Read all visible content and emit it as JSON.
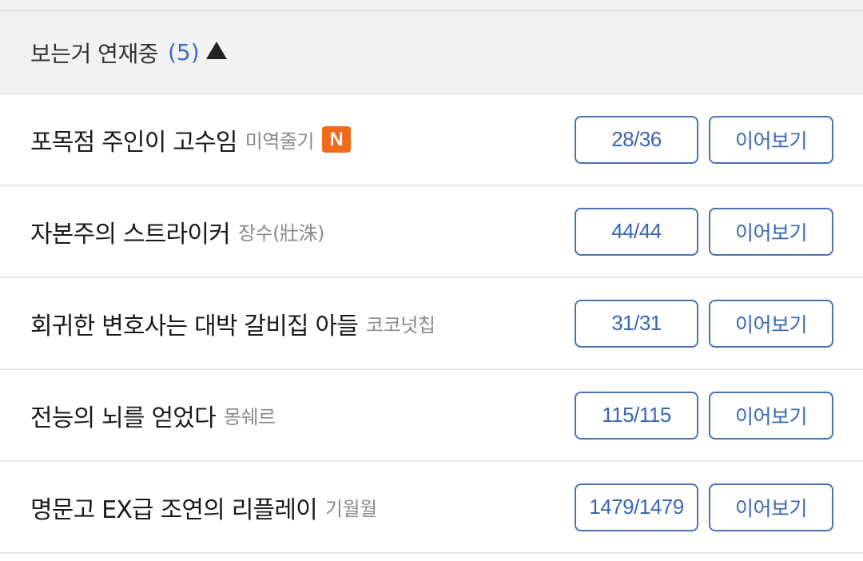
{
  "section": {
    "title": "보는거 연재중",
    "count": "(5)"
  },
  "items": [
    {
      "title": "포목점 주인이 고수임",
      "author": "미역줄기",
      "badge": "N",
      "progress": "28/36",
      "action": "이어보기"
    },
    {
      "title": "자본주의 스트라이커",
      "author": "장수(壯洙)",
      "badge": "",
      "progress": "44/44",
      "action": "이어보기"
    },
    {
      "title": "회귀한 변호사는 대박 갈비집 아들",
      "author": "코코넛칩",
      "badge": "",
      "progress": "31/31",
      "action": "이어보기"
    },
    {
      "title": "전능의 뇌를 얻었다",
      "author": "몽쉐르",
      "badge": "",
      "progress": "115/115",
      "action": "이어보기"
    },
    {
      "title": "명문고 EX급 조연의 리플레이",
      "author": "기월월",
      "badge": "",
      "progress": "1479/1479",
      "action": "이어보기"
    }
  ],
  "colors": {
    "accent": "#3a66b5",
    "badge": "#ef6a1a",
    "header_bg": "#f2f2f2"
  },
  "icons": {
    "toggle": "triangle-up-icon"
  }
}
